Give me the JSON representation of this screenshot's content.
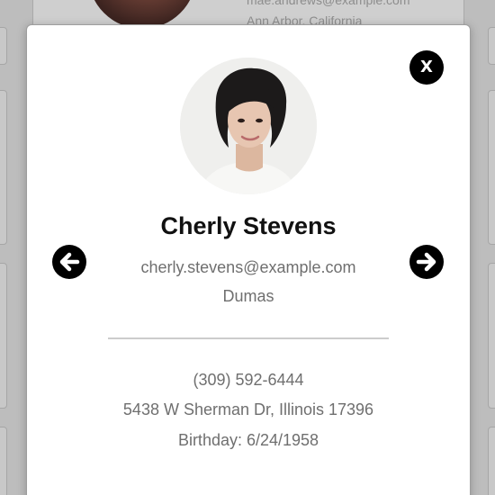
{
  "background": {
    "email": "mae.andrews@example.com",
    "city": "Ann Arbor, California"
  },
  "modal": {
    "close_label": "X",
    "name": "Cherly Stevens",
    "email": "cherly.stevens@example.com",
    "city": "Dumas",
    "phone": "(309) 592-6444",
    "address": "5438 W Sherman Dr, Illinois 17396",
    "birthday": "Birthday: 6/24/1958"
  },
  "icons": {
    "prev": "arrow-left-icon",
    "next": "arrow-right-icon",
    "close": "close-icon"
  },
  "colors": {
    "overlay": "#bdbdbd",
    "modal_bg": "#ffffff",
    "button_bg": "#000000",
    "secondary_text": "#6f6f6f"
  }
}
